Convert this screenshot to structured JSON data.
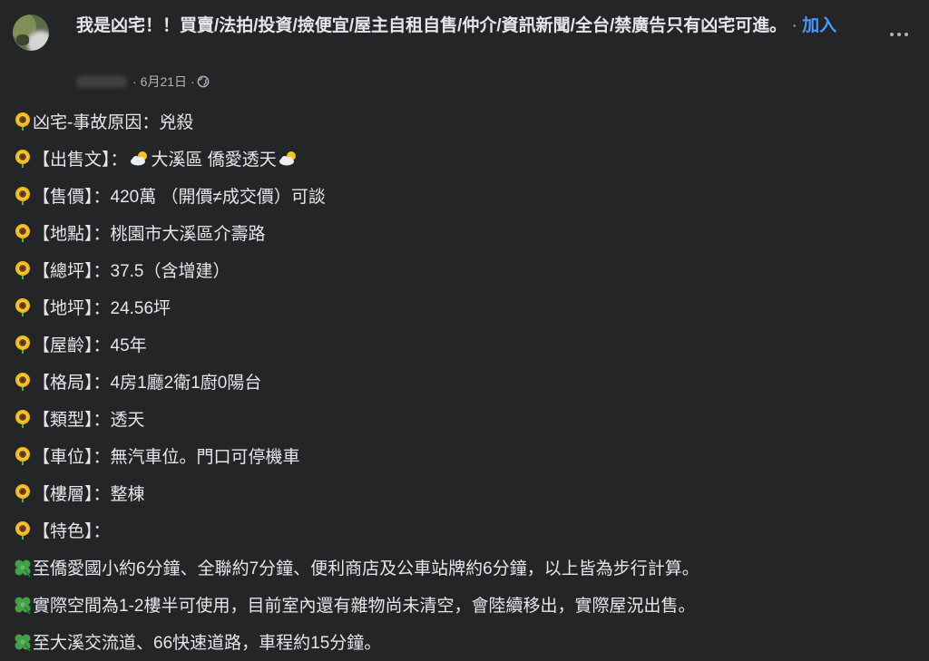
{
  "header": {
    "group_name": "我是凶宅！！買賣/法拍/投資/撿便宜/屋主自租自售/仲介/資訊新聞/全台/禁廣告只有凶宅可進。",
    "separator": "·",
    "join_label": "加入",
    "date": "6月21日",
    "dot": "·"
  },
  "lines": [
    {
      "icon": "sunflower-icon",
      "text": "凶宅-事故原因：兇殺"
    },
    {
      "icon": "sunflower-icon",
      "text": "【出售文】：",
      "weather": true,
      "text_mid": " 大溪區 僑愛透天"
    },
    {
      "icon": "sunflower-icon",
      "text": "【售價】：420萬 （開價≠成交價）可談"
    },
    {
      "icon": "sunflower-icon",
      "text": "【地點】：桃園市大溪區介壽路"
    },
    {
      "icon": "sunflower-icon",
      "text": "【總坪】：37.5（含增建）"
    },
    {
      "icon": "sunflower-icon",
      "text": "【地坪】：24.56坪"
    },
    {
      "icon": "sunflower-icon",
      "text": "【屋齡】：45年"
    },
    {
      "icon": "sunflower-icon",
      "text": "【格局】：4房1廳2衛1廚0陽台"
    },
    {
      "icon": "sunflower-icon",
      "text": "【類型】：透天"
    },
    {
      "icon": "sunflower-icon",
      "text": "【車位】：無汽車位。門口可停機車"
    },
    {
      "icon": "sunflower-icon",
      "text": "【樓層】：整棟"
    },
    {
      "icon": "sunflower-icon",
      "text": "【特色】："
    },
    {
      "icon": "clover-icon",
      "text": " 至僑愛國小約6分鐘、全聯約7分鐘、便利商店及公車站牌約6分鐘，以上皆為步行計算。"
    },
    {
      "icon": "clover-icon",
      "text": " 實際空間為1-2樓半可使用，目前室內還有雜物尚未清空，會陸續移出，實際屋況出售。"
    },
    {
      "icon": "clover-icon",
      "text": "至大溪交流道、66快速道路，車程約15分鐘。"
    }
  ]
}
